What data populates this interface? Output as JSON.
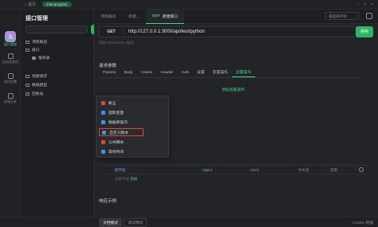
{
  "topbar": {
    "home_label": "首页",
    "env_pill": "mini-program",
    "right_items": [
      "",
      "",
      ""
    ]
  },
  "rail": {
    "items": [
      {
        "label": "接口管理",
        "active": true
      },
      {
        "label": "自动化测试",
        "active": false
      },
      {
        "label": "项目设置",
        "active": false
      },
      {
        "label": "在线分享",
        "active": false
      }
    ]
  },
  "left": {
    "title": "接口管理",
    "search_placeholder": "",
    "add_label": "+",
    "tree": [
      {
        "label": "项目概览",
        "level": 0,
        "kind": "item"
      },
      {
        "label": "接口",
        "level": 0,
        "kind": "item"
      },
      {
        "label": "根目录",
        "level": 1,
        "kind": "folder"
      },
      {
        "label": "快捷请求",
        "level": 0,
        "kind": "item"
      },
      {
        "label": "数据模型",
        "level": 0,
        "kind": "item"
      },
      {
        "label": "回收站",
        "level": 0,
        "kind": "item"
      }
    ]
  },
  "tabs": {
    "items": [
      {
        "label": "项目概览",
        "method": "",
        "active": false
      },
      {
        "label": "新建...",
        "method": "",
        "active": false
      },
      {
        "label": "新建接口",
        "method": "GET",
        "active": true
      }
    ],
    "env_select": "请选择环境"
  },
  "request": {
    "method": "GET",
    "url": "http://127.0.0.1:3000/api/test/python",
    "send_label": "保存",
    "description_placeholder": "添加 Markdown 描述"
  },
  "params": {
    "title": "请求参数",
    "tabs": [
      "Params",
      "Body",
      "Cookie",
      "Header",
      "Auth",
      "设置",
      "前置操作",
      "后置操作"
    ],
    "active_tab": "后置操作",
    "add_post_label": "添加后置操作"
  },
  "menu": {
    "items": [
      {
        "label": "断言",
        "icon": "assert-icon",
        "color": "#e0493a",
        "highlighted": false
      },
      {
        "label": "提取变量",
        "icon": "extract-icon",
        "color": "#4a90e2",
        "highlighted": false
      },
      {
        "label": "数据库操作",
        "icon": "database-icon",
        "color": "#4a90e2",
        "highlighted": false
      },
      {
        "label": "自定义脚本",
        "icon": "script-icon",
        "color": "#4a90e2",
        "highlighted": true
      },
      {
        "label": "公共脚本",
        "icon": "public-script-icon",
        "color": "#e0493a",
        "highlighted": false
      },
      {
        "label": "等待时间",
        "icon": "clock-icon",
        "color": "#4a90e2",
        "highlighted": false
      }
    ]
  },
  "param_row": {
    "name": "新字段",
    "type": "object",
    "mock": "Mock",
    "chinese": "中文名",
    "description": "说明"
  },
  "no_desc": "没有字段",
  "add_label": "添加",
  "response": {
    "title": "响应示例"
  },
  "bottom": {
    "modes": [
      "文档模式",
      "调试模式"
    ],
    "active_mode": "文档模式",
    "right_items": [
      "Cookie 管理"
    ]
  }
}
